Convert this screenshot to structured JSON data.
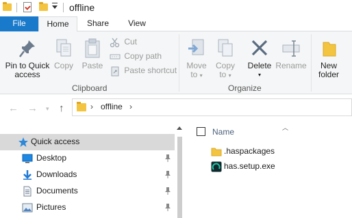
{
  "window": {
    "title": "offline"
  },
  "ribbon_tabs": [
    {
      "label": "File"
    },
    {
      "label": "Home"
    },
    {
      "label": "Share"
    },
    {
      "label": "View"
    }
  ],
  "ribbon": {
    "clipboard": {
      "pin_line1": "Pin to Quick",
      "pin_line2": "access",
      "copy": "Copy",
      "paste": "Paste",
      "cut": "Cut",
      "copy_path": "Copy path",
      "paste_shortcut": "Paste shortcut",
      "group_label": "Clipboard"
    },
    "organize": {
      "move_to_line1": "Move",
      "move_to_line2": "to",
      "copy_to_line1": "Copy",
      "copy_to_line2": "to",
      "delete": "Delete",
      "rename": "Rename",
      "group_label": "Organize"
    },
    "new": {
      "new_folder_line1": "New",
      "new_folder_line2": "folder"
    }
  },
  "address": {
    "path": [
      "offline"
    ]
  },
  "nav_pane": {
    "items": [
      {
        "label": "Quick access",
        "icon": "star-icon"
      },
      {
        "label": "Desktop",
        "icon": "desktop-icon"
      },
      {
        "label": "Downloads",
        "icon": "download-icon"
      },
      {
        "label": "Documents",
        "icon": "documents-icon"
      },
      {
        "label": "Pictures",
        "icon": "pictures-icon"
      }
    ]
  },
  "file_list": {
    "column_name": "Name",
    "files": [
      {
        "name": ".haspackages",
        "icon": "folder-icon"
      },
      {
        "name": "has.setup.exe",
        "icon": "app-icon"
      }
    ]
  },
  "colors": {
    "file_tab": "#1979ca",
    "ribbon_bg": "#f5f6f7",
    "folder": "#f3c440",
    "selected_nav": "#d9d9d9"
  }
}
